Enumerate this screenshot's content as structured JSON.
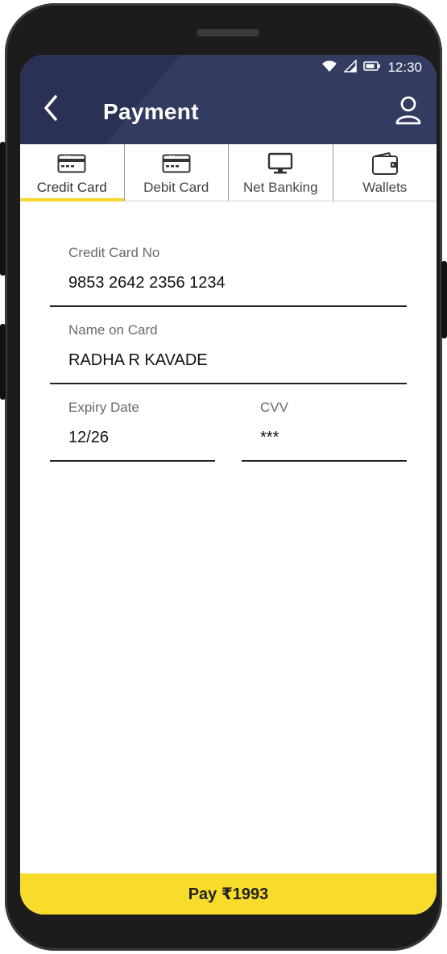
{
  "status_bar": {
    "time": "12:30",
    "icons": [
      "wifi-icon",
      "signal-icon",
      "battery-icon"
    ]
  },
  "header": {
    "title": "Payment",
    "back_icon": "chevron-left-icon",
    "profile_icon": "user-icon"
  },
  "tabs": [
    {
      "label": "Credit Card",
      "icon": "credit-card-icon",
      "active": true
    },
    {
      "label": "Debit Card",
      "icon": "debit-card-icon",
      "active": false
    },
    {
      "label": "Net Banking",
      "icon": "monitor-icon",
      "active": false
    },
    {
      "label": "Wallets",
      "icon": "wallet-icon",
      "active": false
    }
  ],
  "form": {
    "card_number": {
      "label": "Credit Card No",
      "value": "9853 2642 2356 1234"
    },
    "name": {
      "label": "Name on Card",
      "value": "RADHA R KAVADE"
    },
    "expiry": {
      "label": "Expiry Date",
      "value": "12/26"
    },
    "cvv": {
      "label": "CVV",
      "value": "***"
    }
  },
  "pay_button": {
    "label": "Pay ₹1993"
  },
  "colors": {
    "header": "#333b60",
    "accent": "#f8dc2c"
  }
}
